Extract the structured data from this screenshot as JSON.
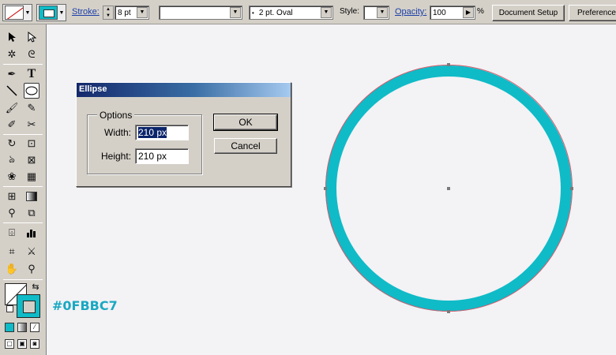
{
  "control_bar": {
    "fill_dropdown": "fill-swatch-icon",
    "stroke_dropdown": "stroke-swatch-icon",
    "stroke_label": "Stroke:",
    "stroke_weight": "8 pt",
    "brush_value": "",
    "brush_definition": "2 pt. Oval",
    "style_label": "Style:",
    "opacity_label": "Opacity:",
    "opacity_value": "100",
    "opacity_unit": "%",
    "document_setup": "Document Setup",
    "preferences": "Preferences"
  },
  "toolbox": {
    "tools": [
      "selection-tool",
      "direct-selection-tool",
      "magic-wand-tool",
      "lasso-tool",
      "pen-tool",
      "type-tool",
      "line-segment-tool",
      "ellipse-tool",
      "paintbrush-tool",
      "pencil-tool",
      "eraser-tool",
      "scissors-tool",
      "rotate-tool",
      "scale-tool",
      "warp-tool",
      "free-transform-tool",
      "symbol-sprayer-tool",
      "column-graph-tool",
      "mesh-tool",
      "gradient-tool",
      "eyedropper-tool",
      "blend-tool",
      "slice-tool",
      "graph-tool",
      "crop-area-tool",
      "knife-tool",
      "hand-tool",
      "zoom-tool"
    ]
  },
  "canvas": {
    "color_hex": "#0FBBC7",
    "stroke_color": "#0fbbc7"
  },
  "dialog": {
    "title": "Ellipse",
    "group_label": "Options",
    "width_label": "Width:",
    "width_value": "210 px",
    "height_label": "Height:",
    "height_value": "210 px",
    "ok_label": "OK",
    "cancel_label": "Cancel"
  }
}
